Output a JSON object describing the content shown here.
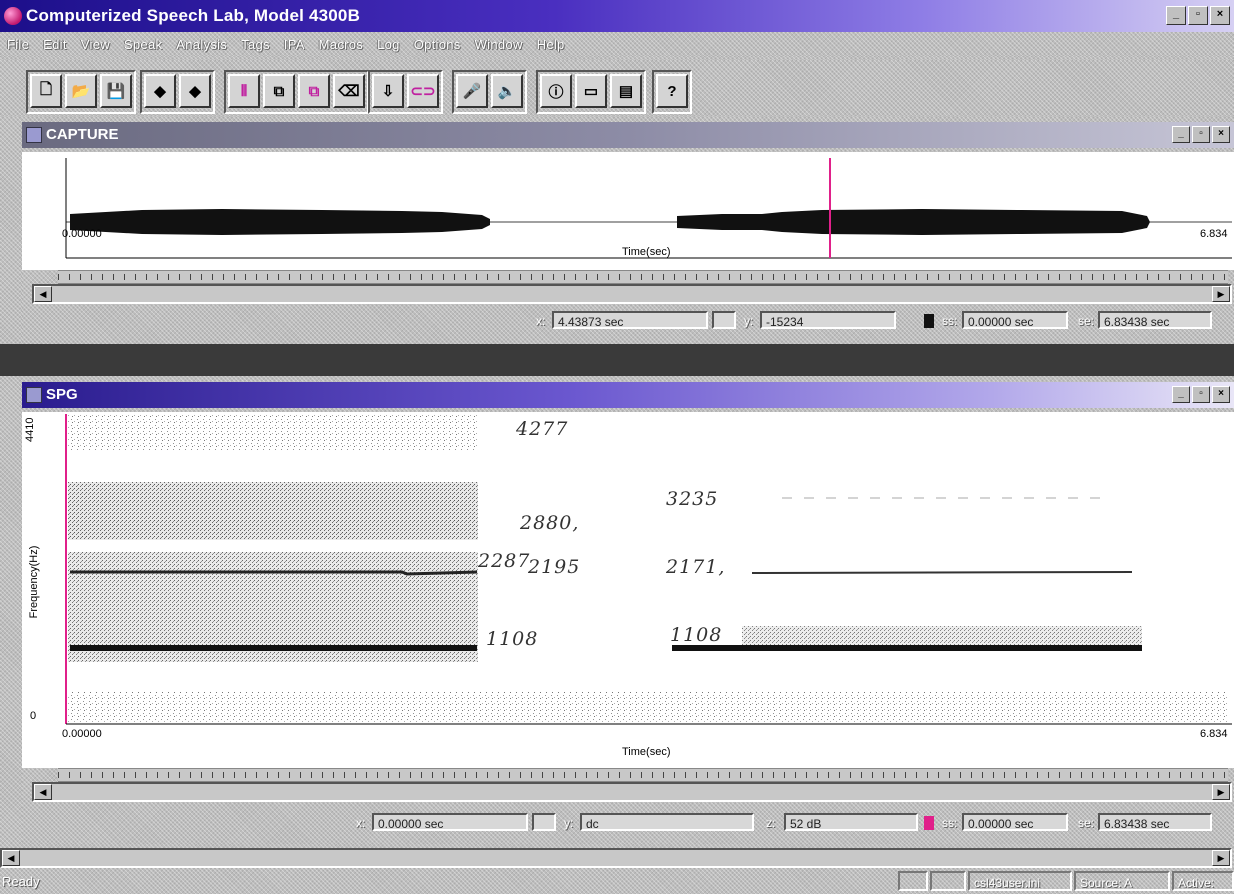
{
  "app": {
    "title": "Computerized Speech Lab, Model 4300B"
  },
  "menu": [
    "File",
    "Edit",
    "View",
    "Speak",
    "Analysis",
    "Tags",
    "IPA",
    "Macros",
    "Log",
    "Options",
    "Window",
    "Help"
  ],
  "capture": {
    "title": "CAPTURE",
    "x_start": "0.00000",
    "x_end": "6.834",
    "xlabel": "Time(sec)",
    "status": {
      "x_label": "x:",
      "x_value": "4.43873 sec",
      "y_label": "y:",
      "y_value": "-15234",
      "ss_label": "ss:",
      "ss_value": "0.00000 sec",
      "se_label": "se:",
      "se_value": "6.83438 sec"
    }
  },
  "spg": {
    "title": "SPG",
    "x_start": "0.00000",
    "x_end": "6.834",
    "xlabel": "Time(sec)",
    "ylabel": "Frequency(Hz)",
    "y_max": "4410",
    "y_min": "0",
    "status": {
      "x_label": "x:",
      "x_value": "0.00000 sec",
      "y_label": "y:",
      "y_value": "dc",
      "z_label": "z:",
      "z_value": "52 dB",
      "ss_label": "ss:",
      "ss_value": "0.00000 sec",
      "se_label": "se:",
      "se_value": "6.83438 sec"
    },
    "annotations": {
      "a1": "4277",
      "a2": "3235",
      "a3": "2880,",
      "a4": "2287",
      "a5": "2195",
      "a6": "2171,",
      "a7": "1108",
      "a8": "1108"
    }
  },
  "statusbar": {
    "ready": "Ready",
    "ini": "csl43user.ini",
    "source": "Source: A",
    "active": "Active:"
  },
  "colors": {
    "title_gradient_start": "#1c0f8a",
    "cursor": "#e0208a",
    "formant": "#111111"
  }
}
